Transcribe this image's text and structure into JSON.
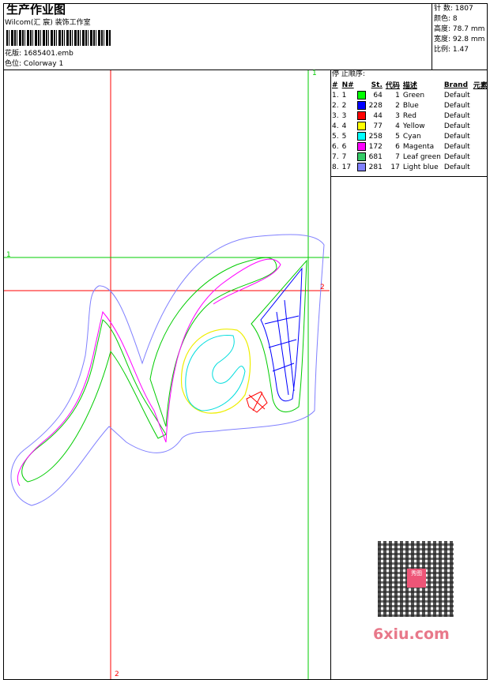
{
  "header": {
    "title": "生产作业图",
    "company": "Wilcom(汇 宸) 装饰工作室",
    "design_file_label": "花版:",
    "design_file": "1685401.emb",
    "colorway_label": "色位:",
    "colorway": "Colorway 1"
  },
  "stats": {
    "stitches_label": "针 数:",
    "stitches": "1807",
    "colors_label": "颜色:",
    "colors": "8",
    "height_label": "高度:",
    "height": "78.7 mm",
    "width_label": "宽度:",
    "width": "92.8 mm",
    "scale_label": "比例:",
    "scale": "1.47"
  },
  "stop_sequence": {
    "title": "停 止顺序:",
    "headers": [
      "#",
      "N#",
      "St.",
      "代码",
      "描述",
      "Brand",
      "元素"
    ],
    "rows": [
      {
        "idx": "1.",
        "n": "1",
        "color": "#00ff00",
        "st": "64",
        "code": "1",
        "desc": "Green",
        "brand": "Default"
      },
      {
        "idx": "2.",
        "n": "2",
        "color": "#0000ff",
        "st": "228",
        "code": "2",
        "desc": "Blue",
        "brand": "Default"
      },
      {
        "idx": "3.",
        "n": "3",
        "color": "#ff0000",
        "st": "44",
        "code": "3",
        "desc": "Red",
        "brand": "Default"
      },
      {
        "idx": "4.",
        "n": "4",
        "color": "#ffff00",
        "st": "77",
        "code": "4",
        "desc": "Yellow",
        "brand": "Default"
      },
      {
        "idx": "5.",
        "n": "5",
        "color": "#00ffff",
        "st": "258",
        "code": "5",
        "desc": "Cyan",
        "brand": "Default"
      },
      {
        "idx": "6.",
        "n": "6",
        "color": "#ff00ff",
        "st": "172",
        "code": "6",
        "desc": "Magenta",
        "brand": "Default"
      },
      {
        "idx": "7.",
        "n": "7",
        "color": "#33cc66",
        "st": "681",
        "code": "7",
        "desc": "Leaf green",
        "brand": "Default"
      },
      {
        "idx": "8.",
        "n": "17",
        "color": "#8080ff",
        "st": "281",
        "code": "17",
        "desc": "Light blue",
        "brand": "Default"
      }
    ]
  },
  "guides": {
    "green_top": "1",
    "green_left": "1",
    "red_right": "2",
    "red_bottom": "2"
  },
  "watermark": {
    "text": "6xiu.com",
    "logo": "秀图"
  }
}
